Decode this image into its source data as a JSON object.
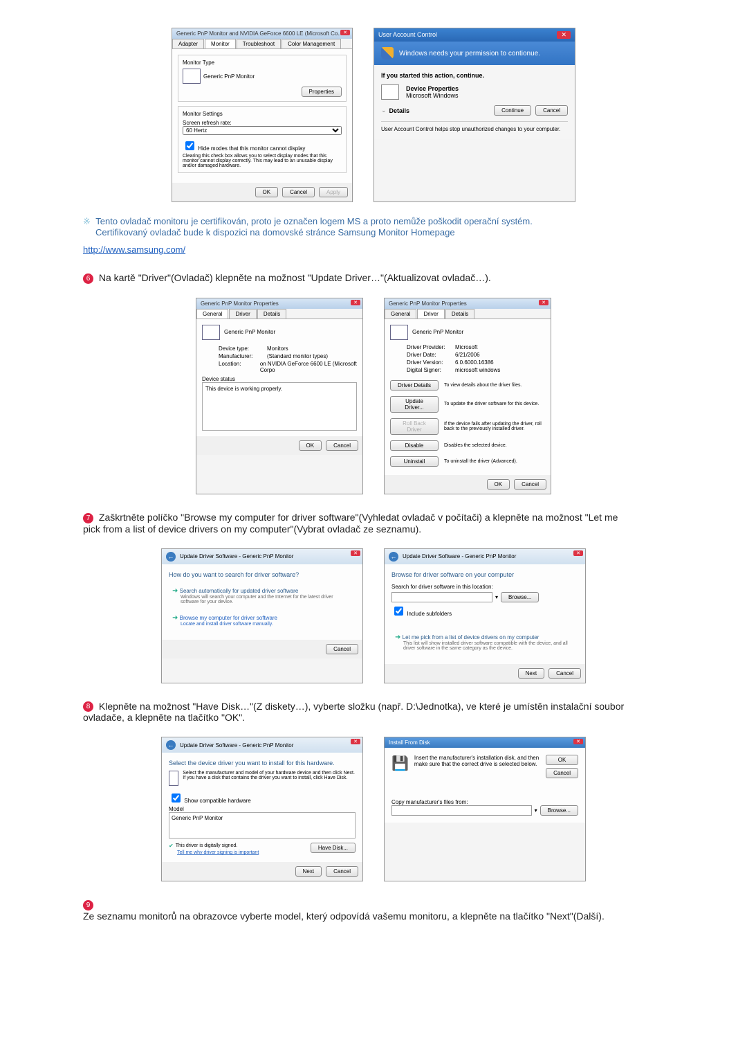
{
  "section1": {
    "monitor_dialog": {
      "title": "Generic PnP Monitor and NVIDIA GeForce 6600 LE (Microsoft Co...",
      "tabs": [
        "Adapter",
        "Monitor",
        "Troubleshoot",
        "Color Management"
      ],
      "monitor_type_label": "Monitor Type",
      "monitor_type_value": "Generic PnP Monitor",
      "properties_btn": "Properties",
      "monitor_settings_label": "Monitor Settings",
      "refresh_label": "Screen refresh rate:",
      "refresh_value": "60 Hertz",
      "hide_modes_cb": "Hide modes that this monitor cannot display",
      "hide_modes_desc": "Clearing this check box allows you to select display modes that this monitor cannot display correctly. This may lead to an unusable display and/or damaged hardware.",
      "ok": "OK",
      "cancel": "Cancel",
      "apply": "Apply"
    },
    "uac": {
      "title": "User Account Control",
      "banner": "Windows needs your permission to contionue.",
      "started": "If you started this action, continue.",
      "dev_prop": "Device Properties",
      "ms_win": "Microsoft Windows",
      "details": "Details",
      "continue": "Continue",
      "cancel": "Cancel",
      "footnote": "User Account Control helps stop unauthorized changes to your computer."
    }
  },
  "note": {
    "line1": "Tento ovladač monitoru je certifikován, proto je označen logem MS a proto nemůže poškodit operační systém.",
    "line2": "Certifikovaný ovladač bude k dispozici na domovské stránce Samsung Monitor Homepage",
    "url": "http://www.samsung.com/"
  },
  "step6": {
    "text": "Na kartě \"Driver\"(Ovladač) klepněte na možnost \"Update Driver…\"(Aktualizovat ovladač…).",
    "general_tab": {
      "title": "Generic PnP Monitor Properties",
      "tabs": [
        "General",
        "Driver",
        "Details"
      ],
      "name": "Generic PnP Monitor",
      "dev_type_l": "Device type:",
      "dev_type_v": "Monitors",
      "manuf_l": "Manufacturer:",
      "manuf_v": "(Standard monitor types)",
      "loc_l": "Location:",
      "loc_v": "on NVIDIA GeForce 6600 LE (Microsoft Corpo",
      "status_l": "Device status",
      "status_v": "This device is working properly.",
      "ok": "OK",
      "cancel": "Cancel"
    },
    "driver_tab": {
      "title": "Generic PnP Monitor Properties",
      "tabs": [
        "General",
        "Driver",
        "Details"
      ],
      "name": "Generic PnP Monitor",
      "provider_l": "Driver Provider:",
      "provider_v": "Microsoft",
      "date_l": "Driver Date:",
      "date_v": "6/21/2006",
      "ver_l": "Driver Version:",
      "ver_v": "6.0.6000.16386",
      "signer_l": "Digital Signer:",
      "signer_v": "microsoft windows",
      "details_btn": "Driver Details",
      "details_d": "To view details about the driver files.",
      "update_btn": "Update Driver...",
      "update_d": "To update the driver software for this device.",
      "rollback_btn": "Roll Back Driver",
      "rollback_d": "If the device fails after updating the driver, roll back to the previously installed driver.",
      "disable_btn": "Disable",
      "disable_d": "Disables the selected device.",
      "uninstall_btn": "Uninstall",
      "uninstall_d": "To uninstall the driver (Advanced).",
      "ok": "OK",
      "cancel": "Cancel"
    }
  },
  "step7": {
    "text": "Zaškrtněte políčko \"Browse my computer for driver software\"(Vyhledat ovladač v počítači) a klepněte na možnost \"Let me pick from a list of device drivers on my computer\"(Vybrat ovladač ze seznamu).",
    "wiz1": {
      "breadcrumb": "Update Driver Software - Generic PnP Monitor",
      "heading": "How do you want to search for driver software?",
      "opt1_t": "Search automatically for updated driver software",
      "opt1_d": "Windows will search your computer and the Internet for the latest driver software for your device.",
      "opt2_t": "Browse my computer for driver software",
      "opt2_d": "Locate and install driver software manually.",
      "cancel": "Cancel"
    },
    "wiz2": {
      "breadcrumb": "Update Driver Software - Generic PnP Monitor",
      "heading": "Browse for driver software on your computer",
      "search_l": "Search for driver software in this location:",
      "browse": "Browse...",
      "include_sub": "Include subfolders",
      "opt_t": "Let me pick from a list of device drivers on my computer",
      "opt_d": "This list will show installed driver software compatible with the device, and all driver software in the same category as the device.",
      "next": "Next",
      "cancel": "Cancel"
    }
  },
  "step8": {
    "text": "Klepněte na možnost \"Have Disk…\"(Z diskety…), vyberte složku (např. D:\\Jednotka), ve které je umístěn instalační soubor ovladače, a klepněte na tlačítko \"OK\".",
    "wiz": {
      "breadcrumb": "Update Driver Software - Generic PnP Monitor",
      "heading": "Select the device driver you want to install for this hardware.",
      "desc": "Select the manufacturer and model of your hardware device and then click Next. If you have a disk that contains the driver you want to install, click Have Disk.",
      "compat_cb": "Show compatible hardware",
      "model_l": "Model",
      "model_v": "Generic PnP Monitor",
      "signed": "This driver is digitally signed.",
      "tell_why": "Tell me why driver signing is important",
      "have_disk": "Have Disk...",
      "next": "Next",
      "cancel": "Cancel"
    },
    "disk": {
      "title": "Install From Disk",
      "desc": "Insert the manufacturer's installation disk, and then make sure that the correct drive is selected below.",
      "ok": "OK",
      "cancel": "Cancel",
      "copy_l": "Copy manufacturer's files from:",
      "browse": "Browse..."
    }
  },
  "step9": {
    "text": "Ze seznamu monitorů na obrazovce vyberte model, který odpovídá vašemu monitoru, a klepněte na tlačítko \"Next\"(Další)."
  }
}
